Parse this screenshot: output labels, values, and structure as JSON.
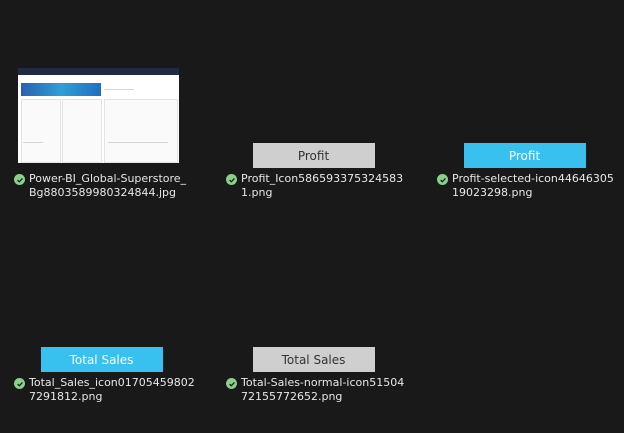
{
  "files": [
    {
      "name_line1": "Power-BI_Global-Superstore_",
      "name_line2": "Bg8803589980324844.jpg",
      "preview": "dashboard"
    },
    {
      "name_line1": "Profit_Icon586593375324583",
      "name_line2": "1.png",
      "preview_label": "Profit",
      "preview_style": "gray"
    },
    {
      "name_line1": "Profit-selected-icon44646305",
      "name_line2": "19023298.png",
      "preview_label": "Profit",
      "preview_style": "blue"
    },
    {
      "name_line1": "Total_Sales_icon01705459802",
      "name_line2": "7291812.png",
      "preview_label": "Total Sales",
      "preview_style": "blue"
    },
    {
      "name_line1": "Total-Sales-normal-icon51504",
      "name_line2": "72155772652.png",
      "preview_label": "Total Sales",
      "preview_style": "gray"
    }
  ],
  "colors": {
    "background": "#191919",
    "gray_button": "#cfcfcf",
    "blue_button": "#38c0ef",
    "check": "#8ad08a"
  },
  "icons": {
    "sync_status": "check-circle-icon"
  }
}
